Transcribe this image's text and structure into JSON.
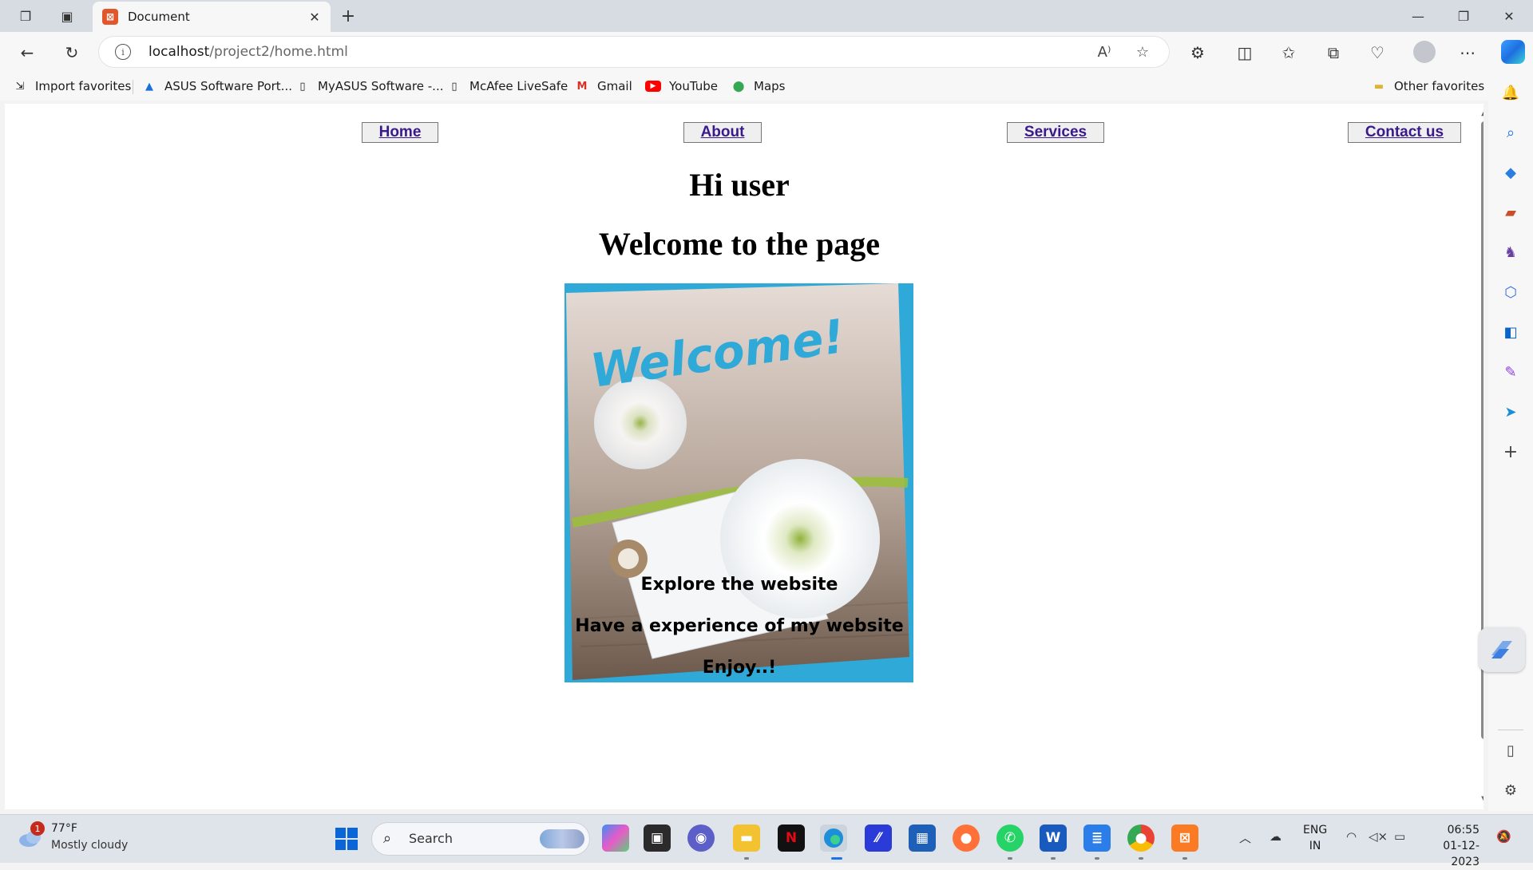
{
  "browser": {
    "tab_title": "Document",
    "address_host": "localhost",
    "address_path": "/project2/home.html"
  },
  "favorites": [
    {
      "label": "Import favorites",
      "icon": "import-icon"
    },
    {
      "label": "ASUS Software Port...",
      "icon": "asus-icon"
    },
    {
      "label": "MyASUS Software -...",
      "icon": "page-icon"
    },
    {
      "label": "McAfee LiveSafe",
      "icon": "page-icon"
    },
    {
      "label": "Gmail",
      "icon": "gmail-icon"
    },
    {
      "label": "YouTube",
      "icon": "youtube-icon"
    },
    {
      "label": "Maps",
      "icon": "maps-icon"
    }
  ],
  "other_favorites": "Other favorites",
  "page": {
    "nav": [
      "Home",
      "About",
      "Services",
      "Contact us"
    ],
    "heading1": "Hi user",
    "heading2": "Welcome to the page",
    "hero_text": "Welcome!",
    "line1": "Explore the website",
    "line2": "Have a experience of my website",
    "line3": "Enjoy..!"
  },
  "taskbar": {
    "weather_badge": "1",
    "temperature": "77°F",
    "condition": "Mostly cloudy",
    "search_placeholder": "Search",
    "lang_top": "ENG",
    "lang_bottom": "IN",
    "time": "06:55",
    "date": "01-12-2023"
  },
  "colors": {
    "nav_link": "#3a1a8a",
    "hero_frame": "#2fa9d8",
    "hero_text": "#2fa9d8"
  }
}
